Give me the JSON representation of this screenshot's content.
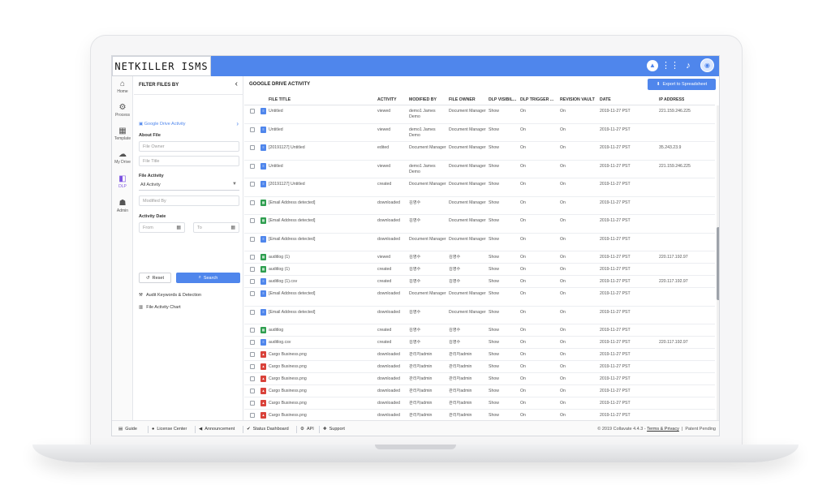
{
  "app": {
    "logo": "NETKILLER ISMS"
  },
  "topbar": {
    "icons": [
      "drive-icon",
      "apps-grid-icon",
      "bell-icon",
      "avatar"
    ]
  },
  "rail": [
    {
      "label": "Home",
      "icon": "home-icon",
      "glyph": "⌂",
      "active": false
    },
    {
      "label": "Process",
      "icon": "process-icon",
      "glyph": "⚙",
      "active": false
    },
    {
      "label": "Template",
      "icon": "template-icon",
      "glyph": "▦",
      "active": false
    },
    {
      "label": "My Drive",
      "icon": "drive-icon",
      "glyph": "☁",
      "active": false
    },
    {
      "label": "DLP",
      "icon": "dlp-icon",
      "glyph": "◧",
      "active": true
    },
    {
      "label": "Admin",
      "icon": "admin-icon",
      "glyph": "☗",
      "active": false
    }
  ],
  "filters": {
    "title": "FILTER FILES BY",
    "source": "Google Drive Activity",
    "about_file_label": "About File",
    "file_owner_placeholder": "File Owner",
    "file_title_placeholder": "File Title",
    "file_activity_label": "File Activity",
    "file_activity_value": "All Activity",
    "modified_by_placeholder": "Modified By",
    "activity_date_label": "Activity Date",
    "from_placeholder": "From",
    "to_placeholder": "To",
    "reset_label": "Reset",
    "search_label": "Search",
    "audit_link": "Audit Keywords & Detection",
    "chart_link": "File Activity Chart"
  },
  "main": {
    "title": "GOOGLE DRIVE ACTIVITY",
    "export_label": "Export to Spreadsheet",
    "columns": [
      "FILE TITLE",
      "ACTIVITY",
      "MODIFIED BY",
      "FILE OWNER",
      "DLP VISIBIL...",
      "DLP TRIGGER ...",
      "REVISION VAULT",
      "DATE",
      "IP ADDRESS"
    ],
    "rows": [
      {
        "type": "doc",
        "title": "Untitled",
        "activity": "viewed",
        "modified": "demo1 James Demo",
        "owner": "Document Manager",
        "vis": "Show",
        "trig": "On",
        "vault": "On",
        "date": "2019-11-27 PST",
        "ip": "221.159.246.225"
      },
      {
        "type": "doc",
        "title": "Untitled",
        "activity": "viewed",
        "modified": "demo1 James Demo",
        "owner": "Document Manager",
        "vis": "Show",
        "trig": "On",
        "vault": "On",
        "date": "2019-11-27 PST",
        "ip": ""
      },
      {
        "type": "doc",
        "title": "[20191127] Untitled",
        "activity": "edited",
        "modified": "Document Manager",
        "owner": "Document Manager",
        "vis": "Show",
        "trig": "On",
        "vault": "On",
        "date": "2019-11-27 PST",
        "ip": "35.243.23.9"
      },
      {
        "type": "doc",
        "title": "Untitled",
        "activity": "viewed",
        "modified": "demo1 James Demo",
        "owner": "Document Manager",
        "vis": "Show",
        "trig": "On",
        "vault": "On",
        "date": "2019-11-27 PST",
        "ip": "221.159.246.225"
      },
      {
        "type": "doc",
        "title": "[20191127] Untitled",
        "activity": "created",
        "modified": "Document Manager",
        "owner": "Document Manager",
        "vis": "Show",
        "trig": "On",
        "vault": "On",
        "date": "2019-11-27 PST",
        "ip": ""
      },
      {
        "type": "sheet",
        "title": "[Email Address detected]",
        "activity": "downloaded",
        "modified": "김영수",
        "owner": "Document Manager",
        "vis": "Show",
        "trig": "On",
        "vault": "On",
        "date": "2019-11-27 PST",
        "ip": ""
      },
      {
        "type": "sheet",
        "title": "[Email Address detected]",
        "activity": "downloaded",
        "modified": "김영수",
        "owner": "Document Manager",
        "vis": "Show",
        "trig": "On",
        "vault": "On",
        "date": "2019-11-27 PST",
        "ip": ""
      },
      {
        "type": "file",
        "title": "[Email Address detected]",
        "activity": "downloaded",
        "modified": "Document Manager",
        "owner": "Document Manager",
        "vis": "Show",
        "trig": "On",
        "vault": "On",
        "date": "2019-11-27 PST",
        "ip": ""
      },
      {
        "type": "sheet",
        "title": "auditlog (1)",
        "activity": "viewed",
        "modified": "김영수",
        "owner": "김영수",
        "vis": "Show",
        "trig": "On",
        "vault": "On",
        "date": "2019-11-27 PST",
        "ip": "220.117.192.97"
      },
      {
        "type": "sheet",
        "title": "auditlog (1)",
        "activity": "created",
        "modified": "김영수",
        "owner": "김영수",
        "vis": "Show",
        "trig": "On",
        "vault": "On",
        "date": "2019-11-27 PST",
        "ip": ""
      },
      {
        "type": "file",
        "title": "auditlog (1).csv",
        "activity": "created",
        "modified": "김영수",
        "owner": "김영수",
        "vis": "Show",
        "trig": "On",
        "vault": "On",
        "date": "2019-11-27 PST",
        "ip": "220.117.192.97"
      },
      {
        "type": "file",
        "title": "[Email Address detected]",
        "activity": "downloaded",
        "modified": "Document Manager",
        "owner": "Document Manager",
        "vis": "Show",
        "trig": "On",
        "vault": "On",
        "date": "2019-11-27 PST",
        "ip": ""
      },
      {
        "type": "file",
        "title": "[Email Address detected]",
        "activity": "downloaded",
        "modified": "김영수",
        "owner": "Document Manager",
        "vis": "Show",
        "trig": "On",
        "vault": "On",
        "date": "2019-11-27 PST",
        "ip": ""
      },
      {
        "type": "sheet",
        "title": "auditlog",
        "activity": "created",
        "modified": "김영수",
        "owner": "김영수",
        "vis": "Show",
        "trig": "On",
        "vault": "On",
        "date": "2019-11-27 PST",
        "ip": ""
      },
      {
        "type": "file",
        "title": "auditlog.csv",
        "activity": "created",
        "modified": "김영수",
        "owner": "김영수",
        "vis": "Show",
        "trig": "On",
        "vault": "On",
        "date": "2019-11-27 PST",
        "ip": "220.117.192.97"
      },
      {
        "type": "img",
        "title": "Cargo Business.png",
        "activity": "downloaded",
        "modified": "관리자admin",
        "owner": "관리자admin",
        "vis": "Show",
        "trig": "On",
        "vault": "On",
        "date": "2019-11-27 PST",
        "ip": ""
      },
      {
        "type": "img",
        "title": "Cargo Business.png",
        "activity": "downloaded",
        "modified": "관리자admin",
        "owner": "관리자admin",
        "vis": "Show",
        "trig": "On",
        "vault": "On",
        "date": "2019-11-27 PST",
        "ip": ""
      },
      {
        "type": "img",
        "title": "Cargo Business.png",
        "activity": "downloaded",
        "modified": "관리자admin",
        "owner": "관리자admin",
        "vis": "Show",
        "trig": "On",
        "vault": "On",
        "date": "2019-11-27 PST",
        "ip": ""
      },
      {
        "type": "img",
        "title": "Cargo Business.png",
        "activity": "downloaded",
        "modified": "관리자admin",
        "owner": "관리자admin",
        "vis": "Show",
        "trig": "On",
        "vault": "On",
        "date": "2019-11-27 PST",
        "ip": ""
      },
      {
        "type": "img",
        "title": "Cargo Business.png",
        "activity": "downloaded",
        "modified": "관리자admin",
        "owner": "관리자admin",
        "vis": "Show",
        "trig": "On",
        "vault": "On",
        "date": "2019-11-27 PST",
        "ip": ""
      },
      {
        "type": "img",
        "title": "Cargo Business.png",
        "activity": "downloaded",
        "modified": "관리자admin",
        "owner": "관리자admin",
        "vis": "Show",
        "trig": "On",
        "vault": "On",
        "date": "2019-11-27 PST",
        "ip": ""
      }
    ]
  },
  "footer": {
    "items": [
      "Guide",
      "License Center",
      "Announcement",
      "Status Dashboard",
      "API",
      "Support"
    ],
    "copyright": "© 2019 Collavate 4.4.3 - ",
    "terms": "Terms & Privacy",
    "patent": "Patent Pending"
  },
  "colors": {
    "accent": "#4f86ec",
    "doc": "#4f86ec",
    "sheet": "#2e9e4f",
    "img": "#d9423a",
    "file": "#4f86ec",
    "dlp_active": "#7b52e0"
  }
}
